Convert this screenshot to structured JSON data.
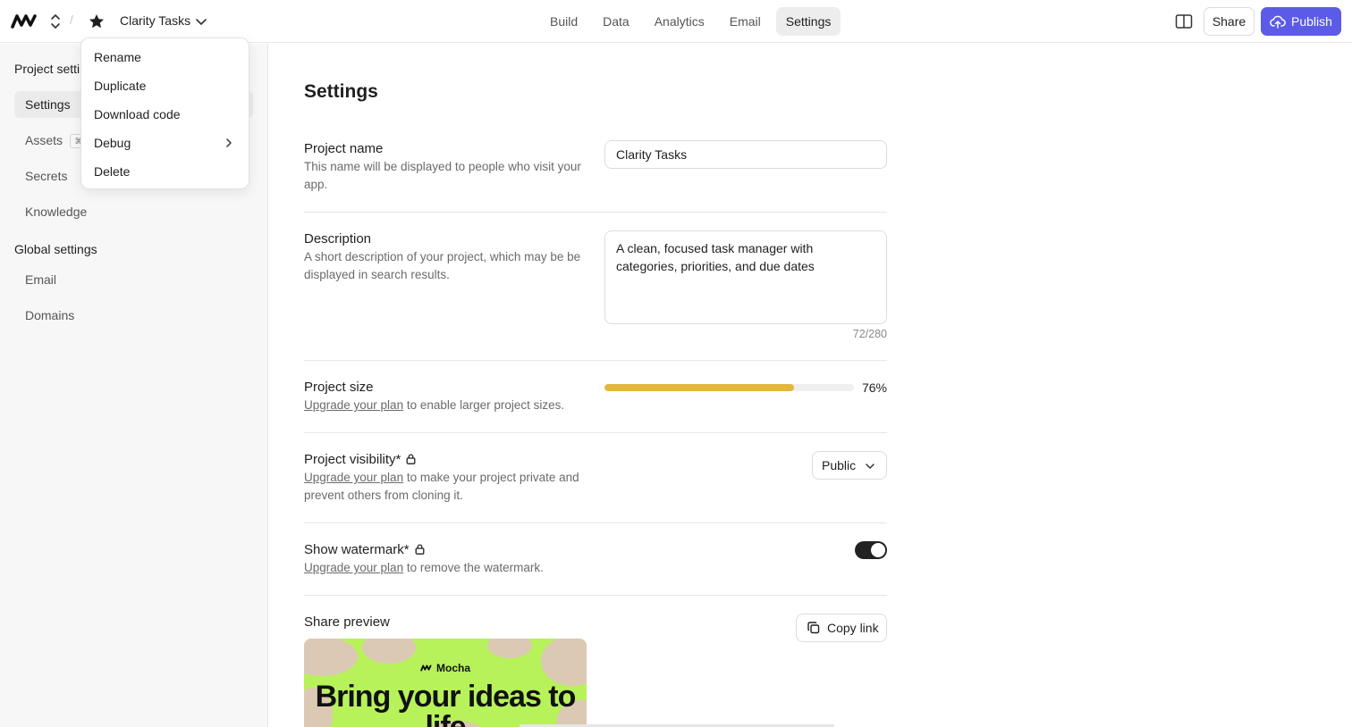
{
  "header": {
    "project_title": "Clarity Tasks",
    "nav": [
      {
        "label": "Build"
      },
      {
        "label": "Data"
      },
      {
        "label": "Analytics"
      },
      {
        "label": "Email"
      },
      {
        "label": "Settings",
        "active": true
      }
    ],
    "share_label": "Share",
    "publish_label": "Publish",
    "accent_color": "#5b5be8"
  },
  "project_menu": {
    "items": [
      {
        "label": "Rename"
      },
      {
        "label": "Duplicate"
      },
      {
        "label": "Download code"
      },
      {
        "label": "Debug",
        "has_submenu": true
      },
      {
        "label": "Delete"
      }
    ]
  },
  "sidebar": {
    "project_heading": "Project setti",
    "project_items": [
      {
        "label": "Settings",
        "active": true
      },
      {
        "label": "Assets",
        "shortcut": "⌘"
      },
      {
        "label": "Secrets"
      },
      {
        "label": "Knowledge"
      }
    ],
    "global_heading": "Global settings",
    "global_items": [
      {
        "label": "Email"
      },
      {
        "label": "Domains"
      }
    ]
  },
  "settings": {
    "title": "Settings",
    "project_name": {
      "label": "Project name",
      "description": "This name will be displayed to people who visit your app.",
      "value": "Clarity Tasks"
    },
    "description": {
      "label": "Description",
      "description": "A short description of your project, which may be be displayed in search results.",
      "value": "A clean, focused task manager with categories, priorities, and due dates",
      "counter": "72/280"
    },
    "project_size": {
      "label": "Project size",
      "upgrade_link": "Upgrade your plan",
      "suffix": " to enable larger project sizes.",
      "percent_label": "76%",
      "percent": 76,
      "bar_color": "#e4b73a"
    },
    "visibility": {
      "label": "Project visibility*",
      "upgrade_link": "Upgrade your plan",
      "suffix": " to make your project private and prevent others from cloning it.",
      "selected": "Public"
    },
    "watermark": {
      "label": "Show watermark*",
      "upgrade_link": "Upgrade your plan",
      "suffix": " to remove the watermark.",
      "enabled": true
    },
    "share_preview": {
      "label": "Share preview",
      "copy_label": "Copy link",
      "brand": "Mocha",
      "headline": "Bring your ideas to life"
    }
  }
}
